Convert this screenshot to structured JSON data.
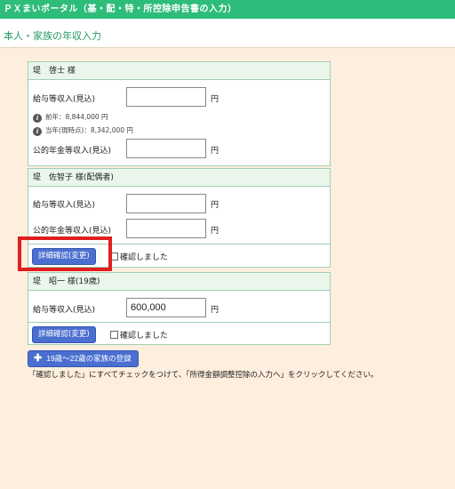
{
  "app": {
    "title": "ＰＸまいポータル（基・配・特・所控除申告書の入力）"
  },
  "page": {
    "title": "本人・家族の年収入力"
  },
  "persons": [
    {
      "name": "堤　啓士 様",
      "salary_label": "給与等収入(見込)",
      "salary_value": "",
      "salary_unit": "円",
      "notes": [
        "前年：8,844,000 円",
        "当年(現時点)：8,342,000 円"
      ],
      "pension_label": "公的年金等収入(見込)",
      "pension_value": "",
      "pension_unit": "円"
    },
    {
      "name": "堤　佐智子 様(配偶者)",
      "salary_label": "給与等収入(見込)",
      "salary_value": "",
      "salary_unit": "円",
      "pension_label": "公的年金等収入(見込)",
      "pension_value": "",
      "pension_unit": "円",
      "detail_button": "詳細確認(変更)",
      "confirm_label": "確認しました"
    },
    {
      "name": "堤　昭一 様(19歳)",
      "salary_label": "給与等収入(見込)",
      "salary_value": "600,000",
      "salary_unit": "円",
      "detail_button": "詳細確認(変更)",
      "confirm_label": "確認しました"
    }
  ],
  "add_family_button": "19歳～22歳の家族の登録",
  "instruction": "「確認しました」にすべてチェックをつけて、「所得金額調整控除の入力へ」をクリックしてください。",
  "colors": {
    "header": "#2ebc7a",
    "button": "#4a6fd0",
    "highlight": "#e11e1e",
    "background": "#fdeedd"
  }
}
